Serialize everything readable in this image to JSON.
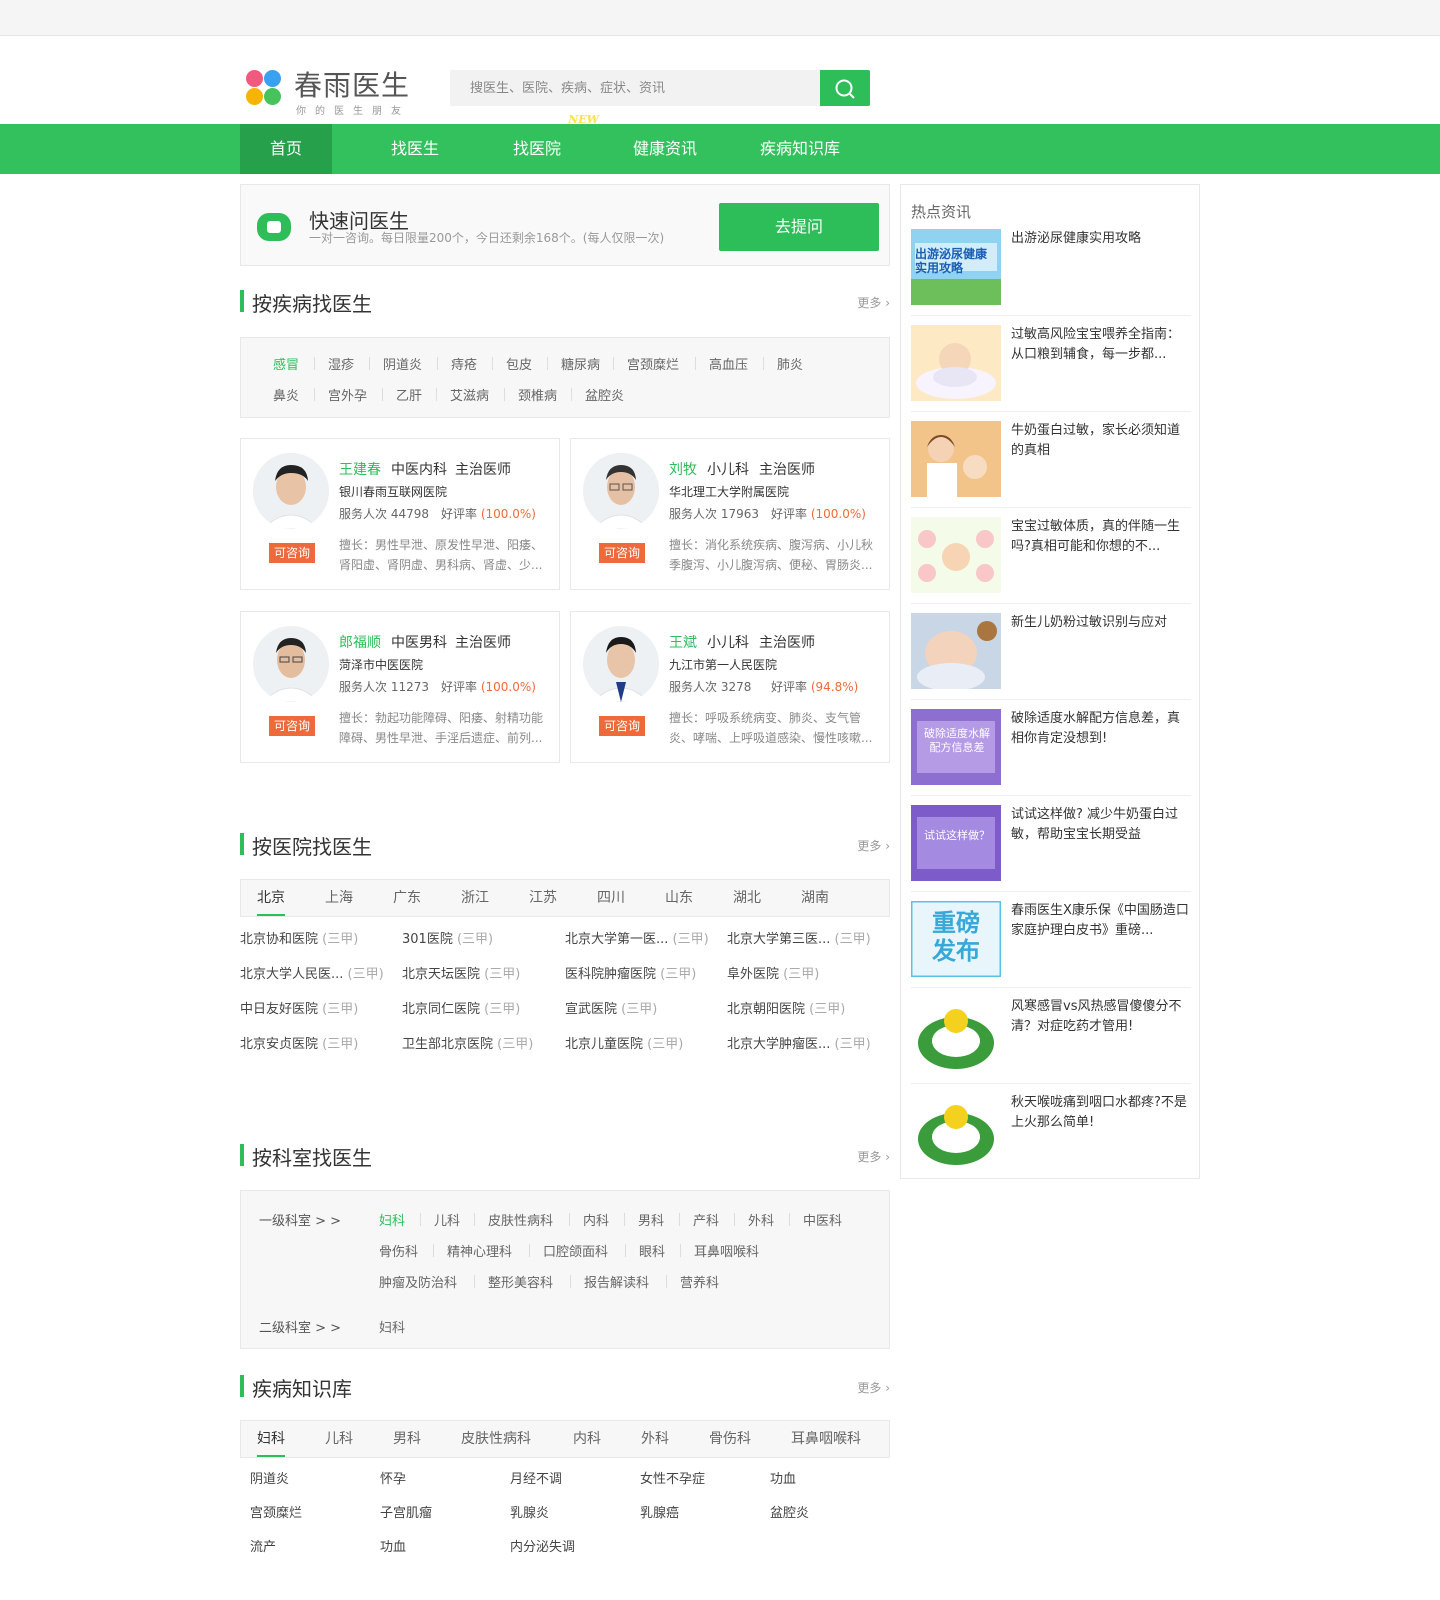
{
  "brand": {
    "name": "春雨医生",
    "slogan": "你的医生朋友"
  },
  "search": {
    "placeholder": "搜医生、医院、疾病、症状、资讯"
  },
  "nav": [
    {
      "label": "首页",
      "active": true
    },
    {
      "label": "找医生"
    },
    {
      "label": "找医院",
      "badge": "NEW"
    },
    {
      "label": "健康资讯"
    },
    {
      "label": "疾病知识库"
    }
  ],
  "quick": {
    "title": "快速问医生",
    "subtitle": "一对一咨询。每日限量200个，今日还剩余168个。(每人仅限一次)",
    "button": "去提问"
  },
  "more_label": "更多",
  "disease_section": {
    "title": "按疾病找医生",
    "tags_row1": [
      "感冒",
      "湿疹",
      "阴道炎",
      "痔疮",
      "包皮",
      "糖尿病",
      "宫颈糜烂",
      "高血压",
      "肺炎"
    ],
    "tags_row2": [
      "鼻炎",
      "宫外孕",
      "乙肝",
      "艾滋病",
      "颈椎病",
      "盆腔炎"
    ]
  },
  "doctors": [
    {
      "name": "王建春",
      "dept": "中医内科",
      "title": "主治医师",
      "hospital": "银川春雨互联网医院",
      "serve_label": "服务人次",
      "serve": "44798",
      "rate_label": "好评率",
      "rate": "(100.0%)",
      "skill": "擅长：男性早泄、原发性早泄、阳痿、肾阳虚、肾阴虚、男科病、肾虚、少...",
      "consult": "可咨询"
    },
    {
      "name": "刘牧",
      "dept": "小儿科",
      "title": "主治医师",
      "hospital": "华北理工大学附属医院",
      "serve_label": "服务人次",
      "serve": "17963",
      "rate_label": "好评率",
      "rate": "(100.0%)",
      "skill": "擅长：消化系统疾病、腹泻病、小儿秋季腹泻、小儿腹泻病、便秘、胃肠炎...",
      "consult": "可咨询"
    },
    {
      "name": "郎福顺",
      "dept": "中医男科",
      "title": "主治医师",
      "hospital": "菏泽市中医医院",
      "serve_label": "服务人次",
      "serve": "11273",
      "rate_label": "好评率",
      "rate": "(100.0%)",
      "skill": "擅长：勃起功能障碍、阳痿、射精功能障碍、男性早泄、手淫后遗症、前列...",
      "consult": "可咨询"
    },
    {
      "name": "王斌",
      "dept": "小儿科",
      "title": "主治医师",
      "hospital": "九江市第一人民医院",
      "serve_label": "服务人次",
      "serve": "3278",
      "rate_label": "好评率",
      "rate": "(94.8%)",
      "skill": "擅长：呼吸系统病变、肺炎、支气管炎、哮喘、上呼吸道感染、慢性咳嗽...",
      "consult": "可咨询"
    }
  ],
  "hospital_section": {
    "title": "按医院找医生",
    "regions": [
      "北京",
      "上海",
      "广东",
      "浙江",
      "江苏",
      "四川",
      "山东",
      "湖北",
      "湖南"
    ],
    "level": "(三甲)",
    "hospitals": [
      [
        "北京协和医院",
        "301医院",
        "北京大学第一医...",
        "北京大学第三医..."
      ],
      [
        "北京大学人民医...",
        "北京天坛医院",
        "医科院肿瘤医院",
        "阜外医院"
      ],
      [
        "中日友好医院",
        "北京同仁医院",
        "宣武医院",
        "北京朝阳医院"
      ],
      [
        "北京安贞医院",
        "卫生部北京医院",
        "北京儿童医院",
        "北京大学肿瘤医..."
      ]
    ]
  },
  "dept_section": {
    "title": "按科室找医生",
    "level1_label": "一级科室 > >",
    "level1_row1": [
      "妇科",
      "儿科",
      "皮肤性病科",
      "内科",
      "男科",
      "产科",
      "外科",
      "中医科"
    ],
    "level1_row2": [
      "骨伤科",
      "精神心理科",
      "口腔颌面科",
      "眼科",
      "耳鼻咽喉科"
    ],
    "level1_row3": [
      "肿瘤及防治科",
      "整形美容科",
      "报告解读科",
      "营养科"
    ],
    "level2_label": "二级科室 > >",
    "level2": [
      "妇科"
    ]
  },
  "kb_section": {
    "title": "疾病知识库",
    "tabs": [
      "妇科",
      "儿科",
      "男科",
      "皮肤性病科",
      "内科",
      "外科",
      "骨伤科",
      "耳鼻咽喉科"
    ],
    "items": [
      [
        "阴道炎",
        "怀孕",
        "月经不调",
        "女性不孕症",
        "功血"
      ],
      [
        "宫颈糜烂",
        "子宫肌瘤",
        "乳腺炎",
        "乳腺癌",
        "盆腔炎"
      ],
      [
        "流产",
        "功血",
        "内分泌失调"
      ]
    ]
  },
  "sidebar": {
    "title": "热点资讯",
    "news": [
      {
        "text": "出游泌尿健康实用攻略",
        "img_text": "出游泌尿健康实用攻略"
      },
      {
        "text": "过敏高风险宝宝喂养全指南：从口粮到辅食，每一步都..."
      },
      {
        "text": "牛奶蛋白过敏，家长必须知道的真相"
      },
      {
        "text": "宝宝过敏体质，真的伴随一生吗?真相可能和你想的不..."
      },
      {
        "text": "新生儿奶粉过敏识别与应对"
      },
      {
        "text": "破除适度水解配方信息差，真相你肯定没想到!",
        "img_text": "破除适度水解配方信息差"
      },
      {
        "text": "试试这样做? 减少牛奶蛋白过敏，帮助宝宝长期受益",
        "img_text": "试试这样做？"
      },
      {
        "text": "春雨医生X康乐保《中国肠造口家庭护理白皮书》重磅...",
        "img_text": "重磅发布"
      },
      {
        "text": "风寒感冒vs风热感冒傻傻分不清？对症吃药才管用!"
      },
      {
        "text": "秋天喉咙痛到咽口水都疼?不是上火那么简单!"
      }
    ]
  },
  "colors": {
    "brand_green": "#33c15e",
    "accent_orange": "#ef6a3a"
  }
}
